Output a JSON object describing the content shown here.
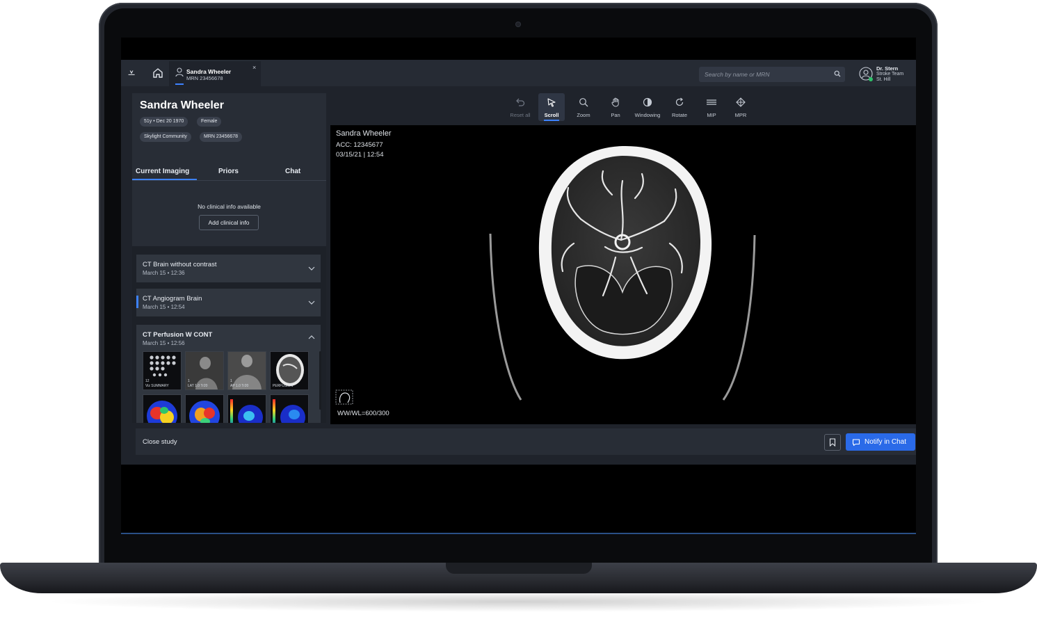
{
  "header": {
    "logo_glyph": "⩡",
    "patient_tab": {
      "name": "Sandra Wheeler",
      "mrn": "MRN 23456678",
      "close_glyph": "×"
    },
    "search": {
      "placeholder": "Search by name or MRN"
    },
    "user": {
      "name": "Dr. Stern",
      "team": "Stroke Team",
      "site": "St. Hill",
      "status_color": "#2ec26a"
    }
  },
  "patient": {
    "name": "Sandra Wheeler",
    "chips": [
      "51y • Dec 20 1970",
      "Female",
      "Skylight Community",
      "MRN 23456678"
    ]
  },
  "tabs": [
    "Current Imaging",
    "Priors",
    "Chat"
  ],
  "clinical": {
    "empty_text": "No clinical info available",
    "add_button": "Add clinical info"
  },
  "studies": [
    {
      "title": "CT Brain without contrast",
      "date": "March 15  •  12:36",
      "expanded": false
    },
    {
      "title": "CT Angiogram Brain",
      "date": "March 15  •  12:54",
      "expanded": false,
      "active": true
    },
    {
      "title": "CT Perfusion W CONT",
      "date": "March 15  •  12:56",
      "expanded": true
    }
  ],
  "thumbnails": [
    {
      "caption": "Viz SUMMARY",
      "count": "12"
    },
    {
      "caption": "LAT 1.0 Tr20",
      "count": "1"
    },
    {
      "caption": "AP 1.0 Tr20",
      "count": "1"
    },
    {
      "caption": "PERFUSION",
      "count": ""
    },
    {
      "caption": "",
      "count": ""
    },
    {
      "caption": "",
      "count": ""
    },
    {
      "caption": "",
      "count": ""
    },
    {
      "caption": "",
      "count": ""
    }
  ],
  "toolbar": {
    "tools": [
      {
        "label": "Reset all",
        "icon": "undo-icon",
        "state": "disabled"
      },
      {
        "label": "Scroll",
        "icon": "cursor-icon",
        "state": "active"
      },
      {
        "label": "Zoom",
        "icon": "zoom-icon",
        "state": "normal"
      },
      {
        "label": "Pan",
        "icon": "hand-icon",
        "state": "normal"
      },
      {
        "label": "Windowing",
        "icon": "contrast-icon",
        "state": "normal"
      },
      {
        "label": "Rotate",
        "icon": "rotate-icon",
        "state": "normal"
      },
      {
        "label": "MIP",
        "icon": "mip-icon",
        "state": "normal"
      },
      {
        "label": "MPR",
        "icon": "mpr-icon",
        "state": "normal"
      }
    ]
  },
  "viewer": {
    "patient_name": "Sandra Wheeler",
    "accession": "ACC: 12345677",
    "datetime": "03/15/21 | 12:54",
    "window_level": "WW/WL=600/300"
  },
  "footer": {
    "close_label": "Close study",
    "notify_label": "Notify in Chat"
  },
  "colors": {
    "accent": "#3d82ff",
    "primary_button": "#2a6ae8",
    "panel": "#282d36",
    "background": "#1f232b"
  }
}
